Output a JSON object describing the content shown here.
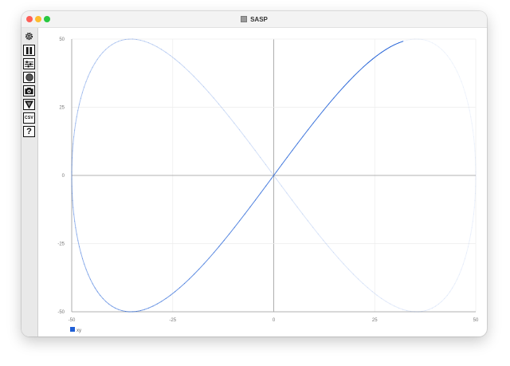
{
  "window": {
    "title": "SASP"
  },
  "toolbar": {
    "items": [
      {
        "name": "settings",
        "icon": "gear-icon"
      },
      {
        "name": "pause",
        "icon": "pause-icon"
      },
      {
        "name": "options",
        "icon": "sliders-icon"
      },
      {
        "name": "record",
        "icon": "record-icon"
      },
      {
        "name": "screenshot",
        "icon": "camera-icon"
      },
      {
        "name": "filter",
        "icon": "funnel-icon"
      },
      {
        "name": "export-csv",
        "icon": "csv-icon",
        "label": "CSV"
      },
      {
        "name": "help",
        "icon": "question-icon",
        "label": "?"
      }
    ]
  },
  "chart_data": {
    "type": "line",
    "xlim": [
      -50,
      50
    ],
    "ylim": [
      -50,
      50
    ],
    "x_ticks": [
      -50,
      -25,
      0,
      25,
      50
    ],
    "y_ticks": [
      50,
      25,
      0,
      -25,
      -50
    ],
    "x_tick_labels": [
      "-50",
      "-25",
      "0",
      "25",
      "50"
    ],
    "y_tick_labels": [
      "50",
      "25",
      "0",
      "-25",
      "-50"
    ],
    "grid": true,
    "legend_position": "bottom-left",
    "series": [
      {
        "name": "xy",
        "color": "#1f5fd6",
        "curve": "lissajous",
        "x_amplitude": 50,
        "y_amplitude": 50,
        "current_point": [
          32,
          50
        ]
      }
    ]
  }
}
